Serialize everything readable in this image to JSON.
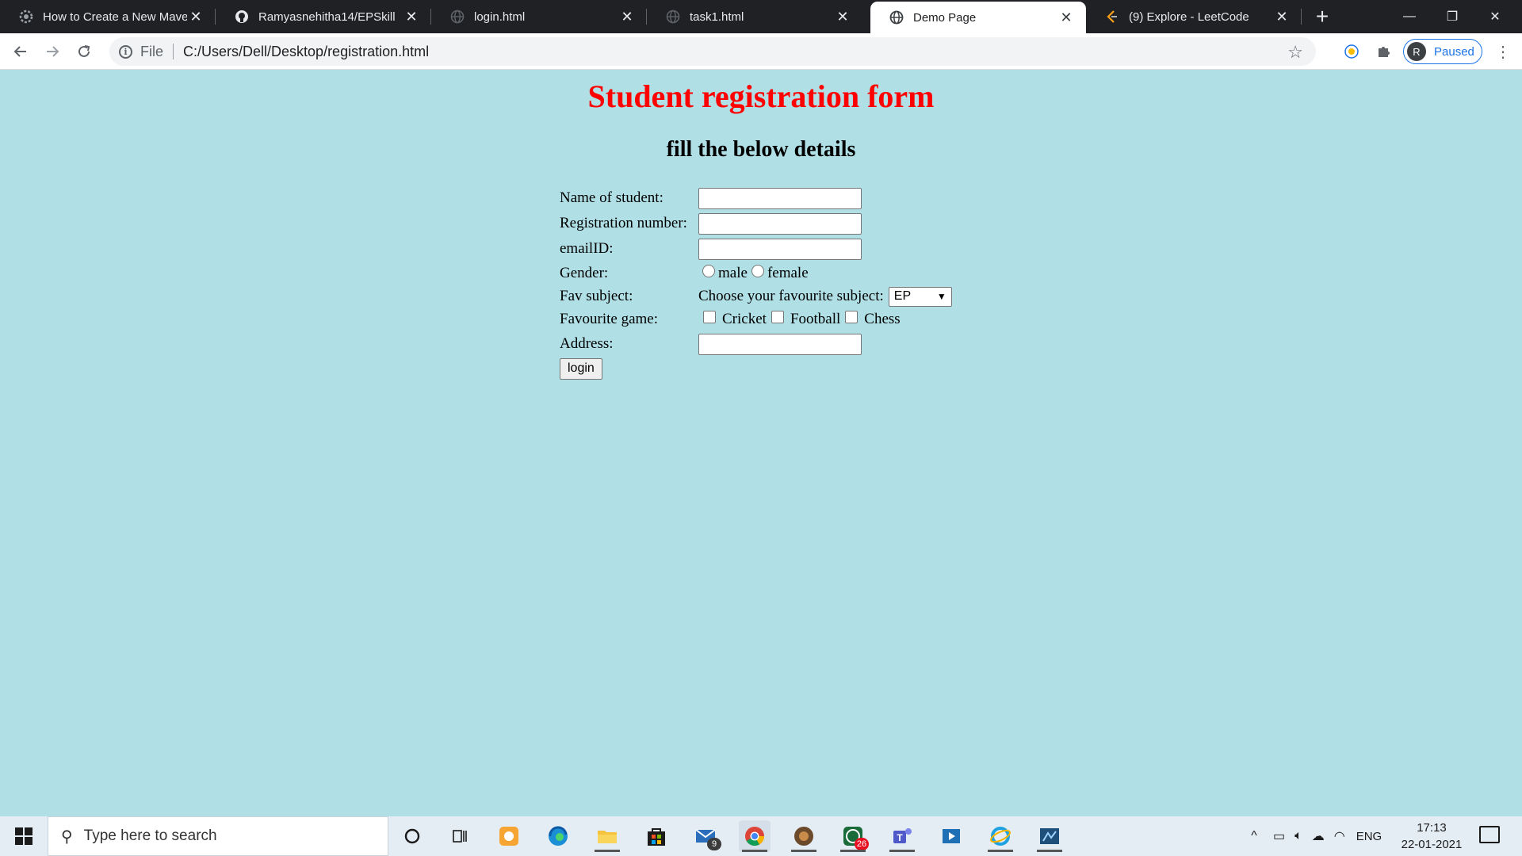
{
  "browser": {
    "tabs": [
      {
        "title": "How to Create a New Maven",
        "icon": "gear-icon",
        "active": false
      },
      {
        "title": "Ramyasnehitha14/EPSkill",
        "icon": "github-icon",
        "active": false
      },
      {
        "title": "login.html",
        "icon": "globe-icon",
        "active": false
      },
      {
        "title": "task1.html",
        "icon": "globe-icon",
        "active": false
      },
      {
        "title": "Demo Page",
        "icon": "globe-icon",
        "active": true
      },
      {
        "title": "(9) Explore - LeetCode",
        "icon": "leetcode-icon",
        "active": false
      }
    ],
    "address": {
      "scheme_label": "File",
      "path": "C:/Users/Dell/Desktop/registration.html"
    },
    "profile": {
      "initial": "R",
      "status": "Paused"
    }
  },
  "page": {
    "title": "Student registration form",
    "subtitle": "fill the below details",
    "form": {
      "name_label": "Name of student:",
      "regno_label": "Registration number:",
      "email_label": "emailID:",
      "gender_label": "Gender:",
      "gender_male": "male",
      "gender_female": "female",
      "subject_label": "Fav subject:",
      "subject_prompt": "Choose your favourite subject:",
      "subject_selected": "EP",
      "game_label": "Favourite game:",
      "game_cricket": "Cricket",
      "game_football": "Football",
      "game_chess": "Chess",
      "address_label": "Address:",
      "submit_label": "login"
    }
  },
  "taskbar": {
    "search_placeholder": "Type here to search",
    "mail_badge": "9",
    "whatsapp_badge": "26",
    "language": "ENG",
    "time": "17:13",
    "date": "22-01-2021"
  },
  "colors": {
    "page_background": "#b0dfe5",
    "title_color": "#ff0000",
    "tabbar": "#202124",
    "profile_accent": "#1a73e8"
  }
}
